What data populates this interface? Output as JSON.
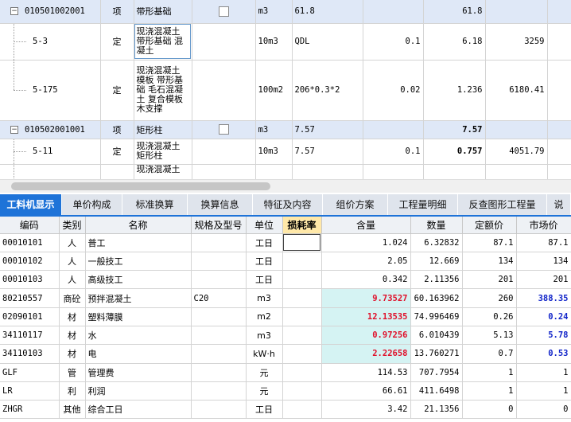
{
  "top_rows": [
    {
      "kind": "section",
      "code": "010501002001",
      "type": "项",
      "name": "带形基础",
      "unit": "m3",
      "expr": "61.8",
      "qty_ratio": "",
      "qty": "61.8",
      "price": ""
    },
    {
      "kind": "sub",
      "code": "5-3",
      "type": "定",
      "name": "现浇混凝土 带形基础 混凝土",
      "unit": "10m3",
      "expr": "QDL",
      "qty_ratio": "0.1",
      "qty": "6.18",
      "price": "3259"
    },
    {
      "kind": "sub",
      "code": "5-175",
      "type": "定",
      "name": "现浇混凝土 模板 带形基础 毛石混凝土 复合模板 木支撑",
      "unit": "100m2",
      "expr": "206*0.3*2",
      "qty_ratio": "0.02",
      "qty": "1.236",
      "price": "6180.41"
    },
    {
      "kind": "section",
      "code": "010502001001",
      "type": "项",
      "name": "矩形柱",
      "unit": "m3",
      "expr": "7.57",
      "qty_ratio": "",
      "qty": "7.57",
      "price": ""
    },
    {
      "kind": "sub",
      "code": "5-11",
      "type": "定",
      "name": "现浇混凝土 矩形柱",
      "unit": "10m3",
      "expr": "7.57",
      "qty_ratio": "0.1",
      "qty": "0.757",
      "price": "4051.79"
    },
    {
      "kind": "sub",
      "code": "",
      "type": "",
      "name": "现浇混凝土",
      "unit": "",
      "expr": "",
      "qty_ratio": "",
      "qty": "",
      "price": ""
    }
  ],
  "tabs": [
    "工料机显示",
    "单价构成",
    "标准换算",
    "换算信息",
    "特征及内容",
    "组价方案",
    "工程量明细",
    "反查图形工程量",
    "说"
  ],
  "columns": [
    "编码",
    "类别",
    "名称",
    "规格及型号",
    "单位",
    "损耗率",
    "含量",
    "数量",
    "定额价",
    "市场价"
  ],
  "rows": [
    {
      "code": "00010101",
      "type": "人",
      "name": "普工",
      "spec": "",
      "unit": "工日",
      "loss": "",
      "content": "1.024",
      "qty": "6.32832",
      "quota": "87.1",
      "market": "87.1",
      "content_style": "",
      "market_style": ""
    },
    {
      "code": "00010102",
      "type": "人",
      "name": "一般技工",
      "spec": "",
      "unit": "工日",
      "loss": "",
      "content": "2.05",
      "qty": "12.669",
      "quota": "134",
      "market": "134",
      "content_style": "",
      "market_style": ""
    },
    {
      "code": "00010103",
      "type": "人",
      "name": "高级技工",
      "spec": "",
      "unit": "工日",
      "loss": "",
      "content": "0.342",
      "qty": "2.11356",
      "quota": "201",
      "market": "201",
      "content_style": "",
      "market_style": ""
    },
    {
      "code": "80210557",
      "type": "商砼",
      "name": "预拌混凝土",
      "spec": "C20",
      "unit": "m3",
      "loss": "",
      "content": "9.73527",
      "qty": "60.163962",
      "quota": "260",
      "market": "388.35",
      "content_style": "red",
      "market_style": "blue"
    },
    {
      "code": "02090101",
      "type": "材",
      "name": "塑料薄膜",
      "spec": "",
      "unit": "m2",
      "loss": "",
      "content": "12.13535",
      "qty": "74.996469",
      "quota": "0.26",
      "market": "0.24",
      "content_style": "red",
      "market_style": "blue"
    },
    {
      "code": "34110117",
      "type": "材",
      "name": "水",
      "spec": "",
      "unit": "m3",
      "loss": "",
      "content": "0.97256",
      "qty": "6.010439",
      "quota": "5.13",
      "market": "5.78",
      "content_style": "red",
      "market_style": "blue"
    },
    {
      "code": "34110103",
      "type": "材",
      "name": "电",
      "spec": "",
      "unit": "kW·h",
      "loss": "",
      "content": "2.22658",
      "qty": "13.760271",
      "quota": "0.7",
      "market": "0.53",
      "content_style": "red",
      "market_style": "blue"
    },
    {
      "code": "GLF",
      "type": "管",
      "name": "管理费",
      "spec": "",
      "unit": "元",
      "loss": "",
      "content": "114.53",
      "qty": "707.7954",
      "quota": "1",
      "market": "1",
      "content_style": "",
      "market_style": ""
    },
    {
      "code": "LR",
      "type": "利",
      "name": "利润",
      "spec": "",
      "unit": "元",
      "loss": "",
      "content": "66.61",
      "qty": "411.6498",
      "quota": "1",
      "market": "1",
      "content_style": "",
      "market_style": ""
    },
    {
      "code": "ZHGR",
      "type": "其他",
      "name": "综合工日",
      "spec": "",
      "unit": "工日",
      "loss": "",
      "content": "3.42",
      "qty": "21.1356",
      "quota": "0",
      "market": "0",
      "content_style": "",
      "market_style": ""
    }
  ]
}
